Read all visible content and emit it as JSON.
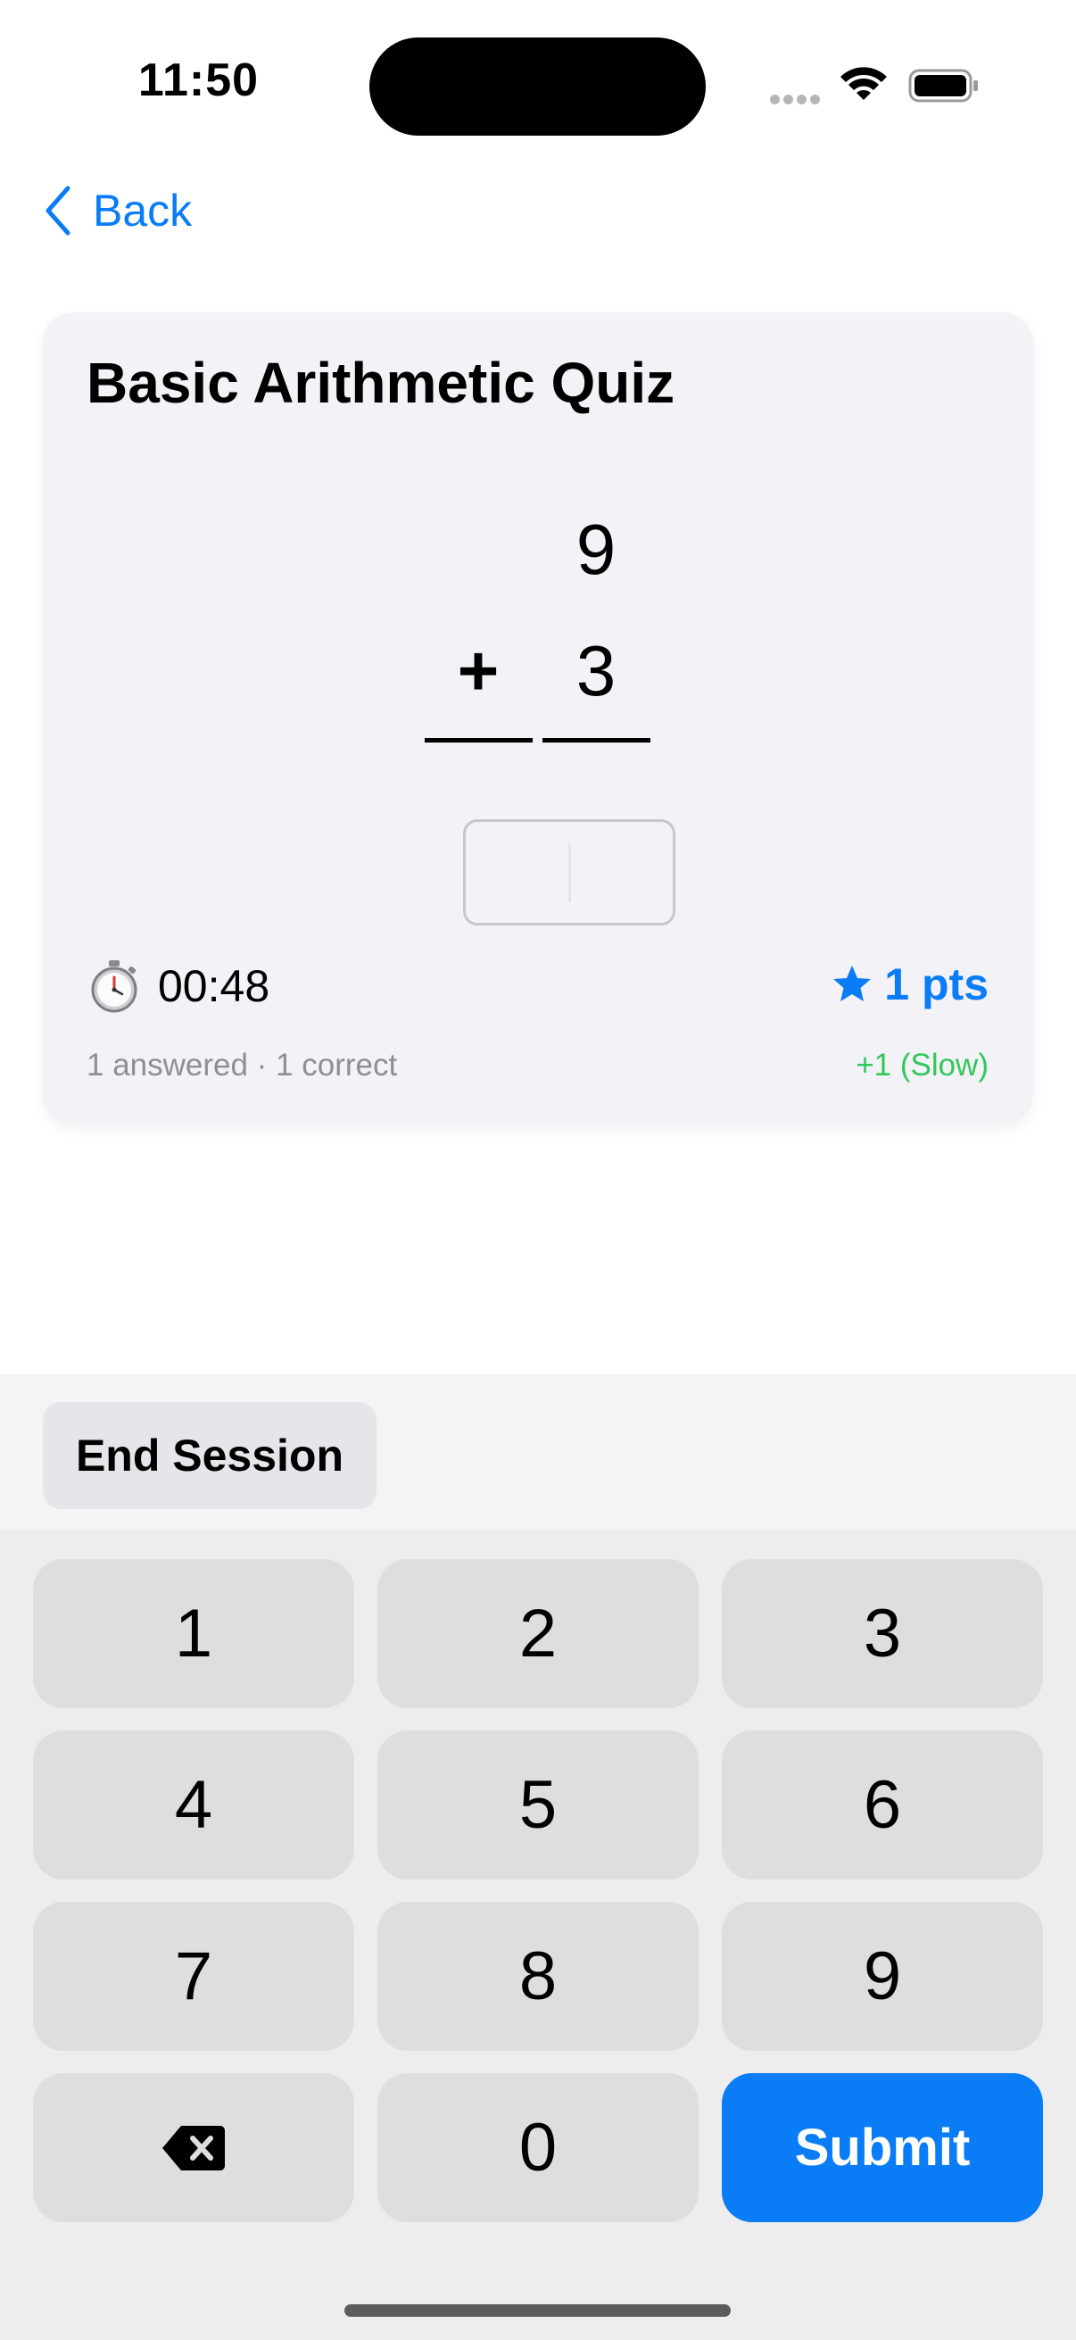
{
  "status_bar": {
    "time": "11:50"
  },
  "nav": {
    "back_label": "Back"
  },
  "quiz": {
    "title": "Basic Arithmetic Quiz",
    "operand_top": "9",
    "operator": "+",
    "operand_bottom": "3",
    "answer_value": "",
    "timer": "00:48",
    "points": "1 pts",
    "stats": "1 answered · 1 correct",
    "last_bonus": "+1 (Slow)"
  },
  "toolbar": {
    "end_session_label": "End Session"
  },
  "keypad": {
    "keys": [
      "1",
      "2",
      "3",
      "4",
      "5",
      "6",
      "7",
      "8",
      "9"
    ],
    "zero": "0",
    "delete_icon": "backspace-icon",
    "submit_label": "Submit"
  },
  "colors": {
    "accent": "#0a7cf5",
    "success": "#34c759",
    "card_bg": "#f2f2f7"
  }
}
